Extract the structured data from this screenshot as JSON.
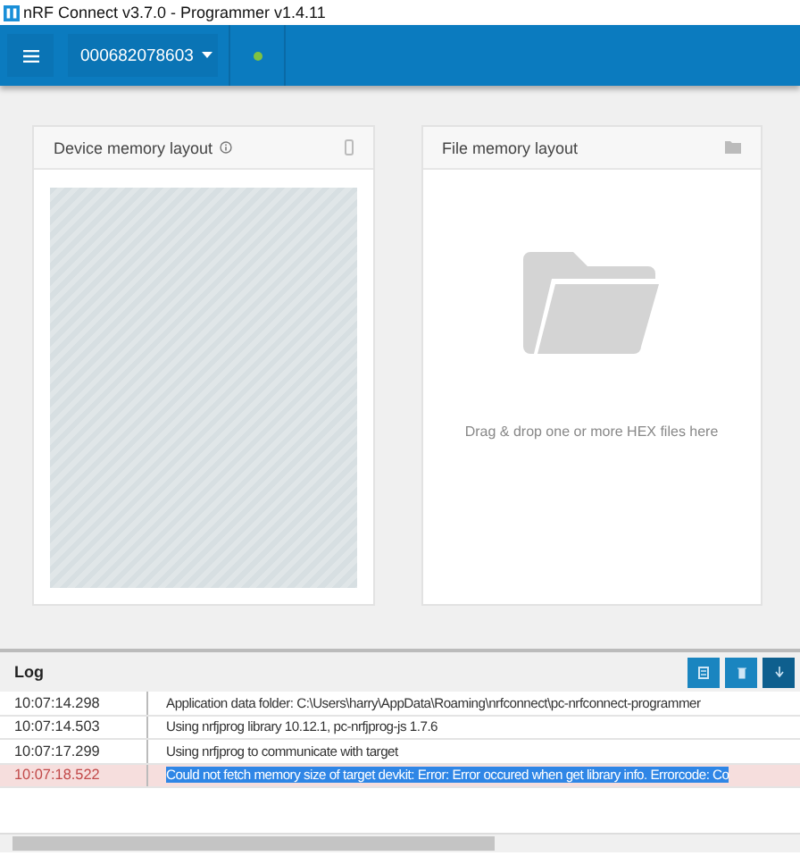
{
  "window": {
    "title": "nRF Connect v3.7.0 - Programmer v1.4.11"
  },
  "toolbar": {
    "device": "000682078603"
  },
  "panels": [
    {
      "kind": "device",
      "title": "Device memory layout"
    },
    {
      "kind": "file",
      "title": "File memory layout",
      "hint": "Drag & drop one or more HEX files here"
    }
  ],
  "log": {
    "title": "Log",
    "rows": [
      {
        "time": "10:07:14.298",
        "message": "Application data folder: C:\\Users\\harry\\AppData\\Roaming\\nrfconnect\\pc-nrfconnect-programmer",
        "kind": "info",
        "selected": false
      },
      {
        "time": "10:07:14.503",
        "message": "Using nrfjprog library 10.12.1, pc-nrfjprog-js 1.7.6",
        "kind": "info",
        "selected": false
      },
      {
        "time": "10:07:17.299",
        "message": "Using nrfjprog to communicate with target",
        "kind": "info",
        "selected": false
      },
      {
        "time": "10:07:18.522",
        "message": "Could not fetch memory size of target devkit: Error: Error occured when get library info. Errorcode: Co",
        "kind": "error",
        "selected": true
      }
    ]
  }
}
